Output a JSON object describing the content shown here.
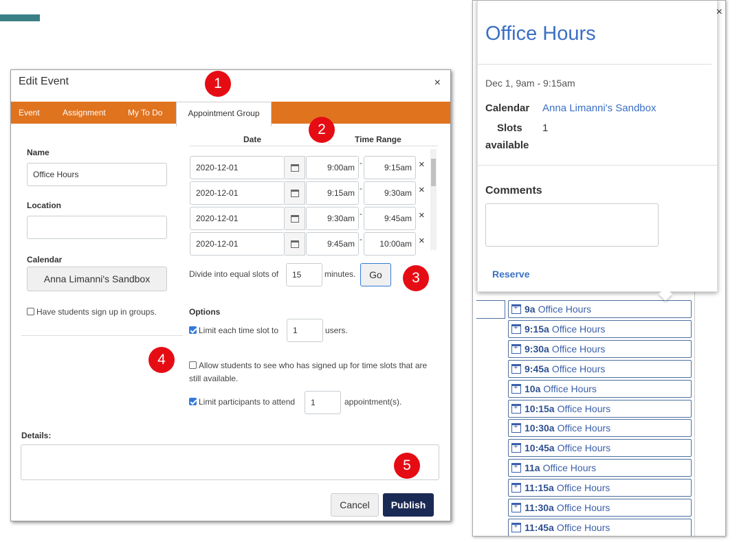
{
  "dialog": {
    "title": "Edit Event",
    "close": "×",
    "tabs": [
      "Event",
      "Assignment",
      "My To Do",
      "Appointment Group"
    ],
    "name_label": "Name",
    "name_value": "Office Hours",
    "location_label": "Location",
    "location_value": "",
    "calendar_label": "Calendar",
    "calendar_value": "Anna Limanni's Sandbox",
    "groups_label": "Have students sign up in groups.",
    "date_header": "Date",
    "time_header": "Time Range",
    "rows": [
      {
        "date": "2020-12-01",
        "start": "9:00am",
        "end": "9:15am"
      },
      {
        "date": "2020-12-01",
        "start": "9:15am",
        "end": "9:30am"
      },
      {
        "date": "2020-12-01",
        "start": "9:30am",
        "end": "9:45am"
      },
      {
        "date": "2020-12-01",
        "start": "9:45am",
        "end": "10:00am"
      }
    ],
    "dash": "-",
    "row_remove": "×",
    "divide_label": "Divide into equal slots of",
    "divide_value": "15",
    "minutes_label": "minutes.",
    "go_label": "Go",
    "options_label": "Options",
    "limit_slot_label": "Limit each time slot to",
    "limit_slot_value": "1",
    "users_label": "users.",
    "allow_see_label": "Allow students to see who has signed up for time slots that are still available.",
    "limit_participants_label": "Limit participants to attend",
    "limit_participants_value": "1",
    "appointments_label": "appointment(s).",
    "details_label": "Details:",
    "cancel_label": "Cancel",
    "publish_label": "Publish"
  },
  "badges": [
    "1",
    "2",
    "3",
    "4",
    "5"
  ],
  "popup": {
    "title": "Office Hours",
    "close": "×",
    "datetime": "Dec 1, 9am - 9:15am",
    "calendar_label": "Calendar",
    "calendar_value": "Anna Limanni's Sandbox",
    "slots_label": "Slots",
    "slots_value": "1",
    "available_label": "available",
    "comments_label": "Comments",
    "reserve_label": "Reserve"
  },
  "slots": [
    {
      "time": "9a",
      "title": "Office Hours"
    },
    {
      "time": "9:15a",
      "title": "Office Hours"
    },
    {
      "time": "9:30a",
      "title": "Office Hours"
    },
    {
      "time": "9:45a",
      "title": "Office Hours"
    },
    {
      "time": "10a",
      "title": "Office Hours"
    },
    {
      "time": "10:15a",
      "title": "Office Hours"
    },
    {
      "time": "10:30a",
      "title": "Office Hours"
    },
    {
      "time": "10:45a",
      "title": "Office Hours"
    },
    {
      "time": "11a",
      "title": "Office Hours"
    },
    {
      "time": "11:15a",
      "title": "Office Hours"
    },
    {
      "time": "11:30a",
      "title": "Office Hours"
    },
    {
      "time": "11:45a",
      "title": "Office Hours"
    }
  ],
  "colors": {
    "tab_orange": "#e0731e",
    "publish": "#1b2a55",
    "badge": "#e60c14",
    "link": "#3a6fc4"
  }
}
